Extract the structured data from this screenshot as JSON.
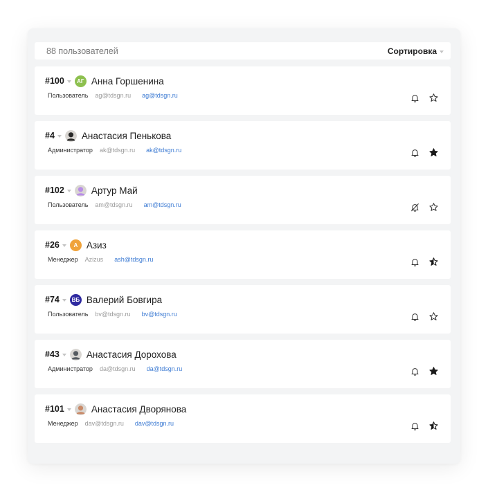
{
  "header": {
    "count_label": "88 пользователей",
    "sort_label": "Сортировка"
  },
  "users": [
    {
      "id": "#100",
      "name": "Анна Горшенина",
      "role": "Пользователь",
      "login": "ag@tdsgn.ru",
      "email": "ag@tdsgn.ru",
      "avatar": {
        "type": "initials",
        "text": "АГ",
        "color": "#8dc04f"
      },
      "notify": "on",
      "star": "empty"
    },
    {
      "id": "#4",
      "name": "Анастасия Пенькова",
      "role": "Администратор",
      "login": "ak@tdsgn.ru",
      "email": "ak@tdsgn.ru",
      "avatar": {
        "type": "photo",
        "text": "",
        "color": "#2a2a2a"
      },
      "notify": "on",
      "star": "filled"
    },
    {
      "id": "#102",
      "name": "Артур Май",
      "role": "Пользователь",
      "login": "am@tdsgn.ru",
      "email": "am@tdsgn.ru",
      "avatar": {
        "type": "photo",
        "text": "",
        "color": "#b98ee6"
      },
      "notify": "off",
      "star": "empty"
    },
    {
      "id": "#26",
      "name": "Азиз",
      "role": "Менеджер",
      "login": "Azizus",
      "email": "ash@tdsgn.ru",
      "avatar": {
        "type": "initials",
        "text": "А",
        "color": "#f0a33b"
      },
      "notify": "on",
      "star": "half"
    },
    {
      "id": "#74",
      "name": "Валерий Бовгира",
      "role": "Пользователь",
      "login": "bv@tdsgn.ru",
      "email": "bv@tdsgn.ru",
      "avatar": {
        "type": "initials",
        "text": "ВБ",
        "color": "#2f2aa0"
      },
      "notify": "on",
      "star": "empty"
    },
    {
      "id": "#43",
      "name": "Анастасия Дорохова",
      "role": "Администратор",
      "login": "da@tdsgn.ru",
      "email": "da@tdsgn.ru",
      "avatar": {
        "type": "photo",
        "text": "",
        "color": "#555a60"
      },
      "notify": "on",
      "star": "filled"
    },
    {
      "id": "#101",
      "name": "Анастасия Дворянова",
      "role": "Менеджер",
      "login": "dav@tdsgn.ru",
      "email": "dav@tdsgn.ru",
      "avatar": {
        "type": "photo",
        "text": "",
        "color": "#c98a68"
      },
      "notify": "on",
      "star": "half"
    }
  ]
}
